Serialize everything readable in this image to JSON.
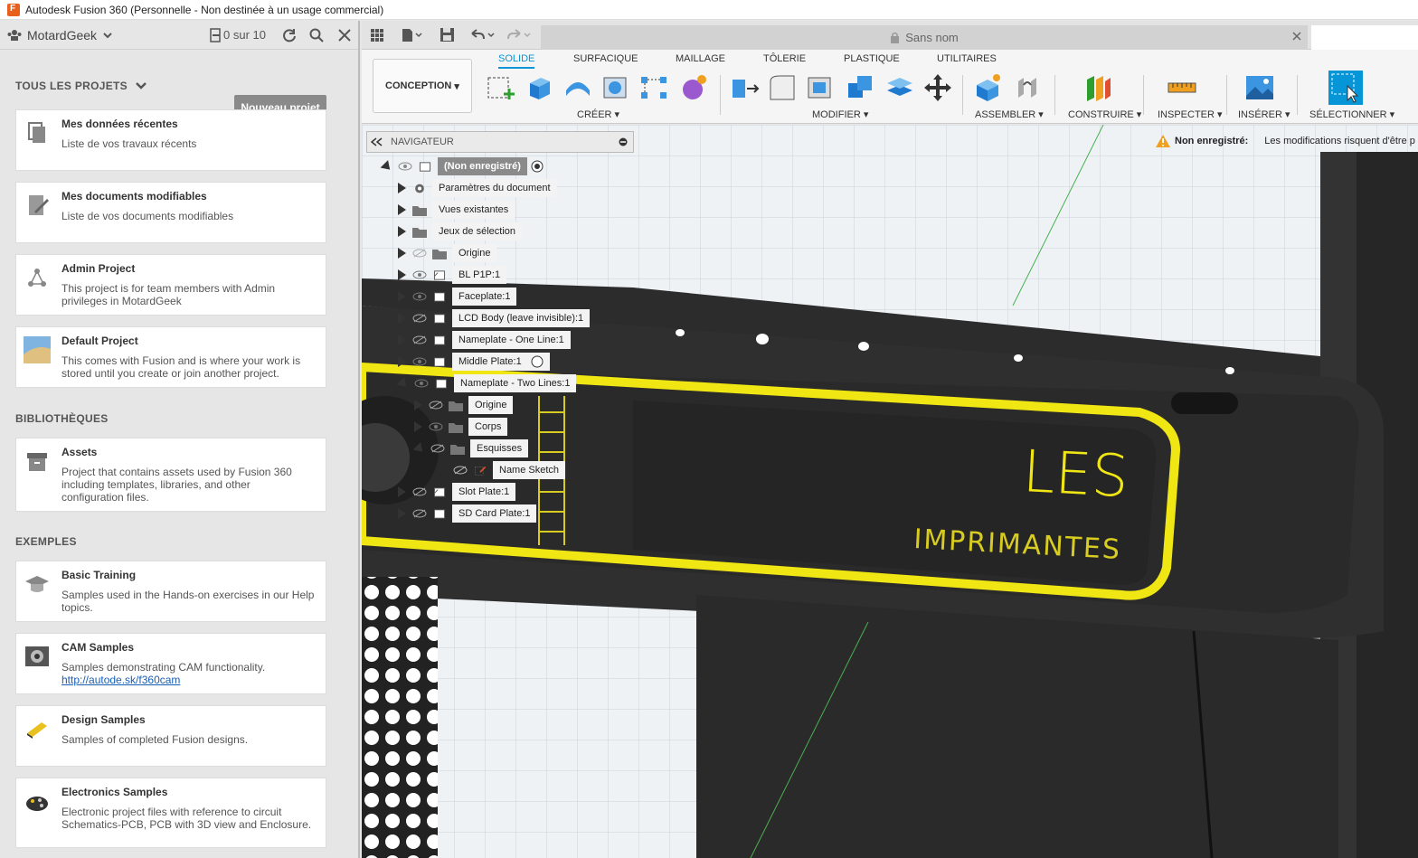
{
  "window": {
    "title": "Autodesk Fusion 360 (Personnelle - Non destinée à un usage commercial)"
  },
  "left_panel": {
    "user": "MotardGeek",
    "jobs": "0 sur 10",
    "all_projects": "TOUS LES PROJETS",
    "new_project": "Nouveau projet",
    "libraries": "BIBLIOTHÈQUES",
    "examples": "EXEMPLES",
    "projects": [
      {
        "title": "Mes données récentes",
        "desc": "Liste de vos travaux récents"
      },
      {
        "title": "Mes documents modifiables",
        "desc": "Liste de vos documents modifiables"
      },
      {
        "title": "Admin Project",
        "desc": "This project is for team members with Admin privileges in MotardGeek"
      },
      {
        "title": "Default Project",
        "desc": "This comes with Fusion and is where your work is stored until you create or join another project."
      }
    ],
    "library_items": [
      {
        "title": "Assets",
        "desc": "Project that contains assets used by Fusion 360 including templates, libraries, and other configuration files."
      }
    ],
    "example_items": [
      {
        "title": "Basic Training",
        "desc": "Samples used in the Hands-on exercises in our Help topics."
      },
      {
        "title": "CAM Samples",
        "desc": "Samples demonstrating CAM functionality.",
        "link": "http://autode.sk/f360cam"
      },
      {
        "title": "Design Samples",
        "desc": "Samples of completed Fusion designs."
      },
      {
        "title": "Electronics Samples",
        "desc": "Electronic project files with reference to circuit Schematics-PCB, PCB with 3D view and Enclosure."
      }
    ]
  },
  "doc_tab": {
    "name": "Sans nom"
  },
  "ribbon": {
    "workspace": "CONCEPTION",
    "tabs": [
      "SOLIDE",
      "SURFACIQUE",
      "MAILLAGE",
      "TÔLERIE",
      "PLASTIQUE",
      "UTILITAIRES"
    ],
    "groups": [
      "CRÉER ▾",
      "MODIFIER ▾",
      "ASSEMBLER ▾",
      "CONSTRUIRE ▾",
      "INSPECTER ▾",
      "INSÉRER ▾",
      "SÉLECTIONNER ▾"
    ]
  },
  "navigator": {
    "title": "NAVIGATEUR",
    "root": "(Non enregistré)",
    "items": [
      "Paramètres du document",
      "Vues existantes",
      "Jeux de sélection",
      "Origine",
      "BL P1P:1",
      "Faceplate:1",
      "LCD Body (leave invisible):1",
      "Nameplate - One Line:1",
      "Middle Plate:1",
      "Nameplate - Two Lines:1",
      "Origine",
      "Corps",
      "Esquisses",
      "Name Sketch",
      "Slot Plate:1",
      "SD Card Plate:1"
    ]
  },
  "warning": {
    "label": "Non enregistré:",
    "text": "Les modifications risquent d'être p"
  },
  "model": {
    "line1": "LES",
    "line2": "IMPRIMANTES"
  }
}
